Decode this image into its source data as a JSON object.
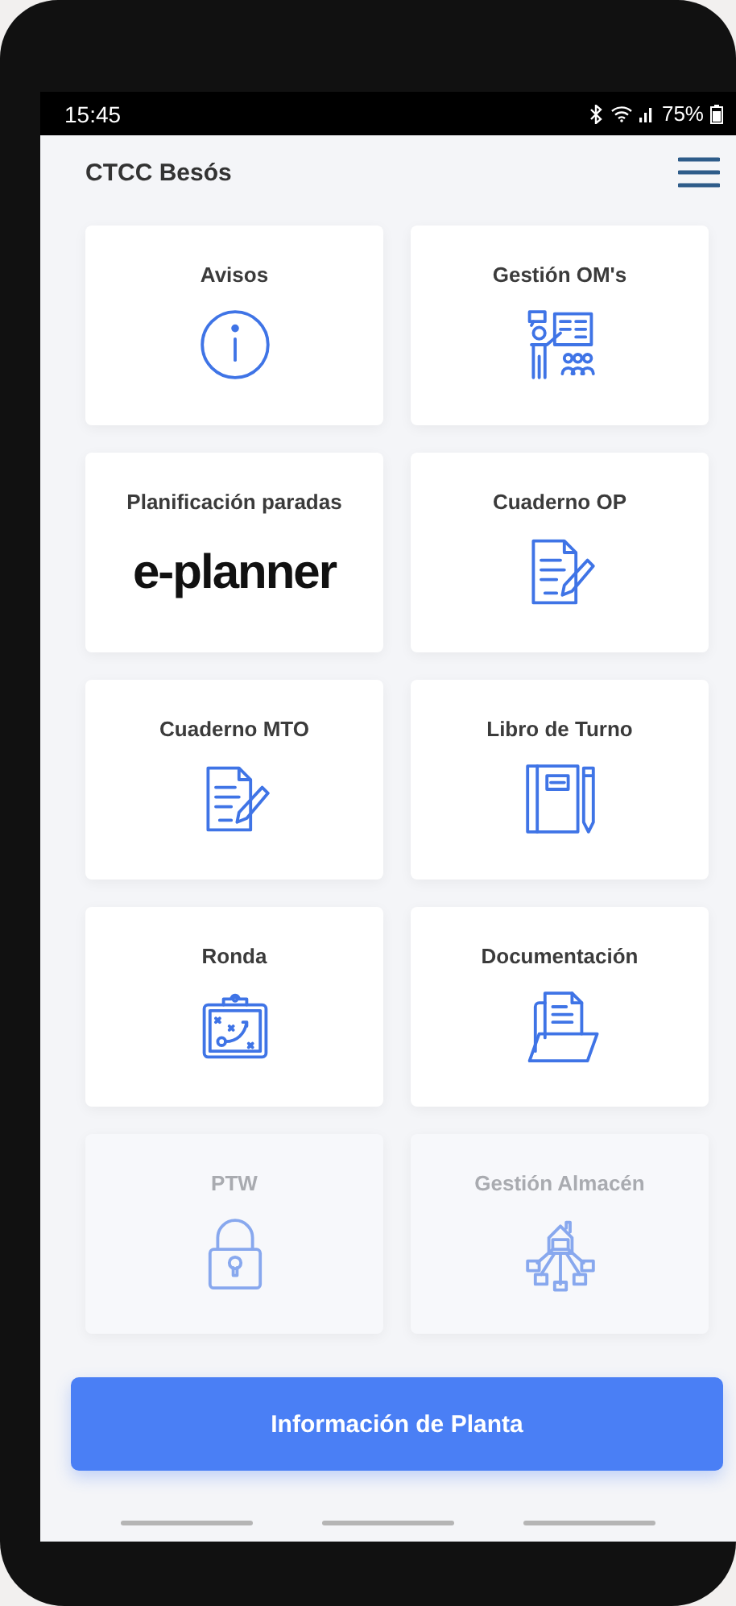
{
  "status_bar": {
    "time": "15:45",
    "battery": "75%"
  },
  "header": {
    "title": "CTCC Besós"
  },
  "tiles": [
    {
      "label": "Avisos",
      "kind": "icon",
      "disabled": false
    },
    {
      "label": "Gestión OM's",
      "kind": "icon",
      "disabled": false
    },
    {
      "label": "Planificación paradas",
      "kind": "logo",
      "logo": "e-planner",
      "disabled": false
    },
    {
      "label": "Cuaderno OP",
      "kind": "icon",
      "disabled": false
    },
    {
      "label": "Cuaderno MTO",
      "kind": "icon",
      "disabled": false
    },
    {
      "label": "Libro de Turno",
      "kind": "icon",
      "disabled": false
    },
    {
      "label": "Ronda",
      "kind": "icon",
      "disabled": false
    },
    {
      "label": "Documentación",
      "kind": "icon",
      "disabled": false
    },
    {
      "label": "PTW",
      "kind": "icon",
      "disabled": true
    },
    {
      "label": "Gestión Almacén",
      "kind": "icon",
      "disabled": true
    }
  ],
  "main_button": {
    "label": "Información de Planta"
  }
}
